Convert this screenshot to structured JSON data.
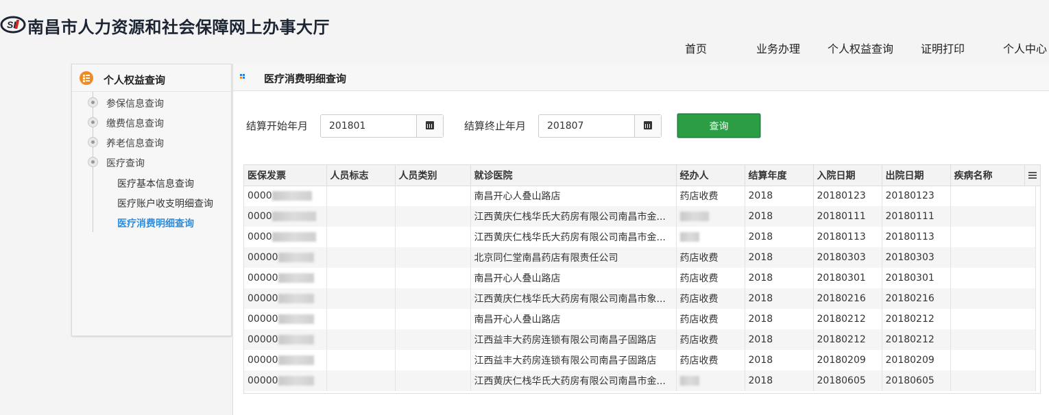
{
  "header": {
    "logo_text": "SI",
    "site_title": "南昌市人力资源和社会保障网上办事大厅",
    "nav": [
      "首页",
      "业务办理",
      "个人权益查询",
      "证明打印",
      "个人中心"
    ]
  },
  "sidebar": {
    "title": "个人权益查询",
    "items": [
      "参保信息查询",
      "缴费信息查询",
      "养老信息查询",
      "医疗查询"
    ],
    "sub_items": [
      "医疗基本信息查询",
      "医疗账户收支明细查询",
      "医疗消费明细查询"
    ],
    "active_sub": "医疗消费明细查询"
  },
  "main": {
    "title": "医疗消费明细查询",
    "start_label": "结算开始年月",
    "start_value": "201801",
    "end_label": "结算终止年月",
    "end_value": "201807",
    "search_label": "查询"
  },
  "table": {
    "columns": [
      "医保发票",
      "人员标志",
      "人员类别",
      "就诊医院",
      "经办人",
      "结算年度",
      "入院日期",
      "出院日期",
      "疾病名称"
    ],
    "rows": [
      [
        "0000",
        "",
        "",
        "南昌开心人叠山路店",
        "药店收费",
        "2018",
        "20180123",
        "20180123",
        ""
      ],
      [
        "0000",
        "",
        "",
        "江西黄庆仁栈华氏大药房有限公司南昌市金...",
        "",
        "2018",
        "20180111",
        "20180111",
        ""
      ],
      [
        "0000",
        "",
        "",
        "江西黄庆仁栈华氏大药房有限公司南昌市金...",
        "",
        "2018",
        "20180113",
        "20180113",
        ""
      ],
      [
        "00000",
        "",
        "",
        "北京同仁堂南昌药店有限责任公司",
        "药店收费",
        "2018",
        "20180303",
        "20180303",
        ""
      ],
      [
        "00000",
        "",
        "",
        "南昌开心人叠山路店",
        "药店收费",
        "2018",
        "20180301",
        "20180301",
        ""
      ],
      [
        "00000",
        "",
        "",
        "江西黄庆仁栈华氏大药房有限公司南昌市象...",
        "药店收费",
        "2018",
        "20180216",
        "20180216",
        ""
      ],
      [
        "00000",
        "",
        "",
        "南昌开心人叠山路店",
        "药店收费",
        "2018",
        "20180212",
        "20180212",
        ""
      ],
      [
        "00000",
        "",
        "",
        "江西益丰大药房连锁有限公司南昌子固路店",
        "药店收费",
        "2018",
        "20180212",
        "20180212",
        ""
      ],
      [
        "00000",
        "",
        "",
        "江西益丰大药房连锁有限公司南昌子固路店",
        "药店收费",
        "2018",
        "20180209",
        "20180209",
        ""
      ],
      [
        "00000",
        "",
        "",
        "江西黄庆仁栈华氏大药房有限公司南昌市金...",
        "",
        "2018",
        "20180605",
        "20180605",
        ""
      ]
    ]
  }
}
